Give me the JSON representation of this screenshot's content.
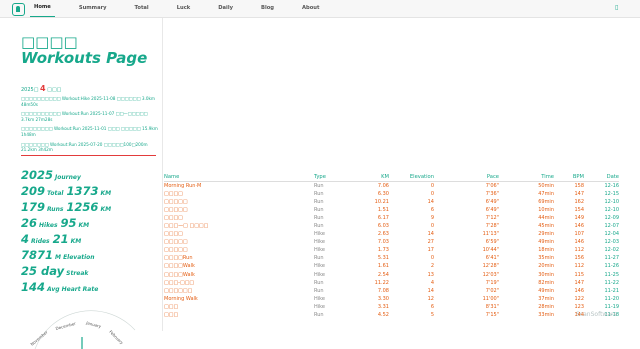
{
  "nav": {
    "items": [
      {
        "label": "Home",
        "active": true
      },
      {
        "label": "Summary",
        "active": false
      },
      {
        "label": "Total",
        "active": false
      },
      {
        "label": "Luck",
        "active": false
      },
      {
        "label": "Daily",
        "active": false
      },
      {
        "label": "Blog",
        "active": false
      },
      {
        "label": "About",
        "active": false
      }
    ]
  },
  "page": {
    "title": "□□□□ Workouts Page",
    "year_prefix": "2025□",
    "year_count": "4",
    "year_suffix": "□□□"
  },
  "recent": [
    "□□□□□□□□□□ Workout:Hike 2025-11-08 □□□□□□ 3.0km 48m50s",
    "□□□□□□□□□□ Workout:Run 2025-11-07 □□—□□□□□ 3.7km 27m28s",
    "□□□□□□□□ Workout:Run 2025-11-01 □□□ □□□□□ 15.9km 1h48m",
    "□□□□□□□ Workout:Run 2025-07-20 □□□□□100□200m 21.2km 3h42m"
  ],
  "stats": [
    {
      "num": "2025",
      "unit": "Journey"
    },
    {
      "num": "209",
      "unit": "Total",
      "num2": "1373",
      "unit2": "KM"
    },
    {
      "num": "179",
      "unit": "Runs",
      "num2": "1256",
      "unit2": "KM"
    },
    {
      "num": "26",
      "unit": "Hikes",
      "num2": "95",
      "unit2": "KM"
    },
    {
      "num": "4",
      "unit": "Rides",
      "num2": "21",
      "unit2": "KM"
    },
    {
      "num": "7871",
      "unit": "M Elevation"
    },
    {
      "num": "25 day",
      "unit": "Streak"
    },
    {
      "num": "144",
      "unit": "Avg Heart Rate"
    }
  ],
  "radial": {
    "months": [
      "November",
      "December",
      "January",
      "February"
    ]
  },
  "table": {
    "headers": [
      "Name",
      "Type",
      "KM",
      "Elevation",
      "Pace",
      "Time",
      "BPM",
      "Date"
    ],
    "rows": [
      [
        "Morning Run·M",
        "Run",
        "7.06",
        "0",
        "7'06\"",
        "50min",
        "158",
        "12-16"
      ],
      [
        "□□□□",
        "Run",
        "6.30",
        "0",
        "7'36\"",
        "47min",
        "147",
        "12-15"
      ],
      [
        "□□□□□",
        "Run",
        "10.21",
        "14",
        "6'49\"",
        "69min",
        "162",
        "12-10"
      ],
      [
        "□□□□□",
        "Run",
        "1.51",
        "6",
        "6'49\"",
        "10min",
        "154",
        "12-10"
      ],
      [
        "□□□□",
        "Run",
        "6.17",
        "9",
        "7'12\"",
        "44min",
        "149",
        "12-09"
      ],
      [
        "□□□—□ □□□□",
        "Run",
        "6.03",
        "0",
        "7'28\"",
        "45min",
        "146",
        "12-07"
      ],
      [
        "□□□□",
        "Hike",
        "2.63",
        "14",
        "11'13\"",
        "29min",
        "107",
        "12-04"
      ],
      [
        "□□□□□",
        "Hike",
        "7.03",
        "27",
        "6'59\"",
        "49min",
        "146",
        "12-03"
      ],
      [
        "□□□□□",
        "Hike",
        "1.73",
        "17",
        "10'44\"",
        "18min",
        "112",
        "12-02"
      ],
      [
        "□□□□Run",
        "Run",
        "5.31",
        "0",
        "6'41\"",
        "35min",
        "156",
        "11-27"
      ],
      [
        "□□□□Walk",
        "Hike",
        "1.61",
        "2",
        "12'28\"",
        "20min",
        "112",
        "11-26"
      ],
      [
        "□□□□Walk",
        "Hike",
        "2.54",
        "13",
        "12'03\"",
        "30min",
        "115",
        "11-25"
      ],
      [
        "□□□-□□□",
        "Run",
        "11.22",
        "4",
        "7'19\"",
        "82min",
        "147",
        "11-22"
      ],
      [
        "□□□□□□",
        "Run",
        "7.08",
        "14",
        "7'02\"",
        "49min",
        "146",
        "11-21"
      ],
      [
        "Morning Walk",
        "Hike",
        "3.30",
        "12",
        "11'00\"",
        "37min",
        "122",
        "11-20"
      ],
      [
        "□□□",
        "Hike",
        "3.31",
        "6",
        "8'31\"",
        "28min",
        "123",
        "11-19"
      ],
      [
        "□□□",
        "Run",
        "4.52",
        "5",
        "7'15\"",
        "33min",
        "144",
        "11-18"
      ]
    ]
  },
  "watermark": "ScanSoftware",
  "colors": {
    "accent": "#17a88b",
    "run": "#e45d12",
    "highlight": "#e23b3b"
  }
}
